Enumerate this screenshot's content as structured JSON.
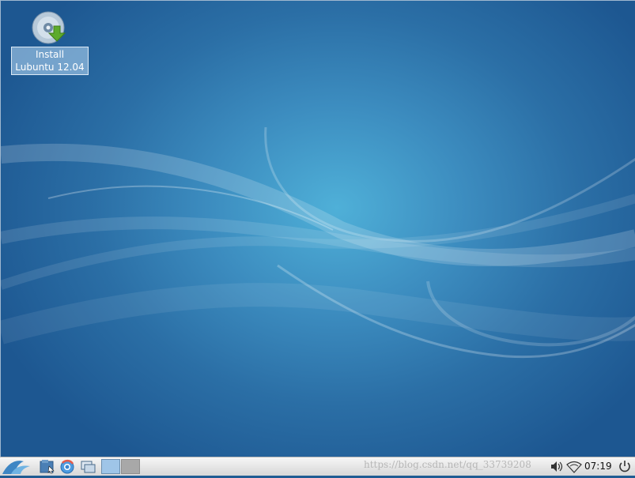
{
  "desktop": {
    "icons": [
      {
        "label_line1": "Install",
        "label_line2": "Lubuntu 12.04",
        "icon": "disc-install-icon"
      }
    ]
  },
  "taskbar": {
    "menu_icon": "lubuntu-logo-icon",
    "launchers": [
      "file-manager-icon",
      "browser-icon",
      "show-desktop-icon"
    ],
    "workspaces": [
      {
        "name": "workspace-1",
        "active": true,
        "color": "#9fc5e8"
      },
      {
        "name": "workspace-2",
        "active": false,
        "color": "#a8a8a8"
      }
    ],
    "watermark": "https://blog.csdn.net/qq_33739208",
    "tray": {
      "volume_icon": "volume-icon",
      "network_icon": "wifi-icon",
      "clock": "07:19",
      "power_icon": "power-icon"
    }
  }
}
